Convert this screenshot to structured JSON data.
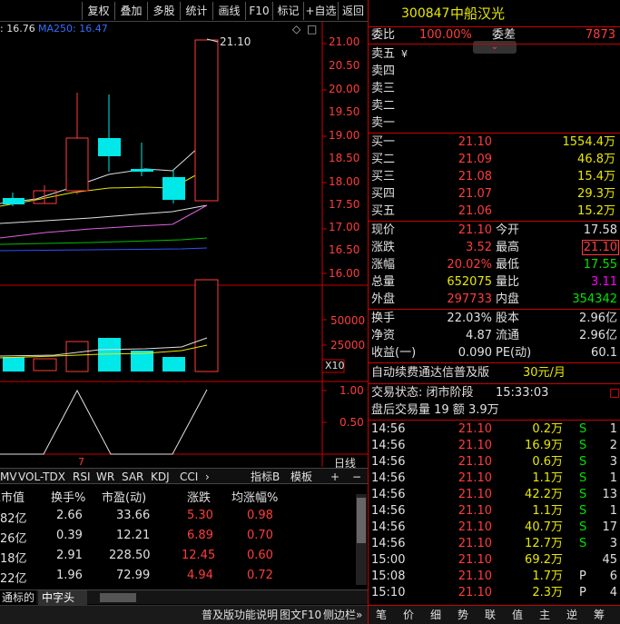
{
  "toolbar": {
    "buttons": [
      "复权",
      "叠加",
      "多股",
      "统计",
      "画线",
      "F10",
      "标记",
      "+自选",
      "返回"
    ]
  },
  "chart": {
    "ma_label_a": ": 16.76",
    "ma_label_b": "MA250: 16.47",
    "high_annotation": "21.10",
    "price_ticks": [
      "21.00",
      "20.50",
      "20.00",
      "19.50",
      "19.00",
      "18.50",
      "18.00",
      "17.50",
      "17.00",
      "16.50",
      "16.00"
    ],
    "vol_ticks": [
      "50000",
      "25000"
    ],
    "vol_unit": "X10",
    "ind_ticks": [
      "1.00",
      "0.50"
    ],
    "period": "日线",
    "xlabel": "7",
    "diamond": "◇",
    "square": "□"
  },
  "indicators": {
    "tabs": [
      "MV",
      "VOL-TDX",
      "RSI",
      "WR",
      "SAR",
      "KDJ",
      "CCI",
      "›"
    ],
    "right": [
      "指标B",
      "模板",
      "+",
      "−"
    ]
  },
  "table": {
    "headers": [
      "总市值",
      "换手%",
      "市盈(动)",
      "涨跌",
      "均涨幅%"
    ],
    "rows": [
      [
        "82亿",
        "2.66",
        "33.66",
        "5.30",
        "0.98"
      ],
      [
        "26亿",
        "0.39",
        "12.21",
        "6.89",
        "0.70"
      ],
      [
        "18亿",
        "2.91",
        "228.50",
        "12.45",
        "0.60"
      ],
      [
        "22亿",
        "1.96",
        "72.99",
        "4.94",
        "0.72"
      ]
    ]
  },
  "bottom": {
    "tab_a": "通标的",
    "tab_b": "中字头",
    "status": [
      "普及版功能说明",
      "图文F10",
      "侧边栏»"
    ]
  },
  "stock": {
    "code": "300847",
    "name": "中船汉光"
  },
  "weibi": {
    "label": "委比",
    "value": "100.00%",
    "label2": "委差",
    "value2": "7873"
  },
  "sell": [
    {
      "label": "卖五",
      "mark": "¥",
      "price": "",
      "vol": ""
    },
    {
      "label": "卖四",
      "price": "",
      "vol": ""
    },
    {
      "label": "卖三",
      "price": "",
      "vol": ""
    },
    {
      "label": "卖二",
      "price": "",
      "vol": ""
    },
    {
      "label": "卖一",
      "price": "",
      "vol": ""
    }
  ],
  "buy": [
    {
      "label": "买一",
      "price": "21.10",
      "vol": "1554.4万"
    },
    {
      "label": "买二",
      "price": "21.09",
      "vol": "46.8万"
    },
    {
      "label": "买三",
      "price": "21.08",
      "vol": "15.4万"
    },
    {
      "label": "买四",
      "price": "21.07",
      "vol": "29.3万"
    },
    {
      "label": "买五",
      "price": "21.06",
      "vol": "15.2万"
    }
  ],
  "quote": {
    "xj_l": "现价",
    "xj": "21.10",
    "jk_l": "今开",
    "jk": "17.58",
    "zd_l": "涨跌",
    "zd": "3.52",
    "zg_l": "最高",
    "zg": "21.10",
    "zf_l": "涨幅",
    "zf": "20.02%",
    "zd2_l": "最低",
    "zd2": "17.55",
    "zl_l": "总量",
    "zl": "652075",
    "lb_l": "量比",
    "lb": "3.11",
    "wp_l": "外盘",
    "wp": "297733",
    "np_l": "内盘",
    "np": "354342",
    "hs_l": "换手",
    "hs": "22.03%",
    "gb_l": "股本",
    "gb": "2.96亿",
    "jz_l": "净资",
    "jz": "4.87",
    "lt_l": "流通",
    "lt": "2.96亿",
    "sy_l": "收益(一)",
    "sy": "0.090",
    "pe_l": "PE(动)",
    "pe": "60.1"
  },
  "promo": {
    "text": "自动续费通达信普及版",
    "price": "30元/月"
  },
  "trade": {
    "state": "交易状态: 闭市阶段",
    "time": "15:33:03",
    "after": "盘后交易量 19 额 3.9万"
  },
  "ticks": [
    [
      "14:56",
      "21.10",
      "0.2万",
      "S",
      "1"
    ],
    [
      "14:56",
      "21.10",
      "16.9万",
      "S",
      "2"
    ],
    [
      "14:56",
      "21.10",
      "0.6万",
      "S",
      "3"
    ],
    [
      "14:56",
      "21.10",
      "1.1万",
      "S",
      "1"
    ],
    [
      "14:56",
      "21.10",
      "42.2万",
      "S",
      "13"
    ],
    [
      "14:56",
      "21.10",
      "1.1万",
      "S",
      "1"
    ],
    [
      "14:56",
      "21.10",
      "40.7万",
      "S",
      "17"
    ],
    [
      "14:56",
      "21.10",
      "12.7万",
      "S",
      "3"
    ],
    [
      "15:00",
      "21.10",
      "69.2万",
      "",
      "45"
    ],
    [
      "15:08",
      "21.10",
      "1.7万",
      "P",
      "6"
    ],
    [
      "15:10",
      "21.10",
      "2.3万",
      "P",
      "4"
    ]
  ],
  "rtabs": [
    "笔",
    "价",
    "细",
    "势",
    "联",
    "值",
    "主",
    "逆",
    "筹"
  ]
}
